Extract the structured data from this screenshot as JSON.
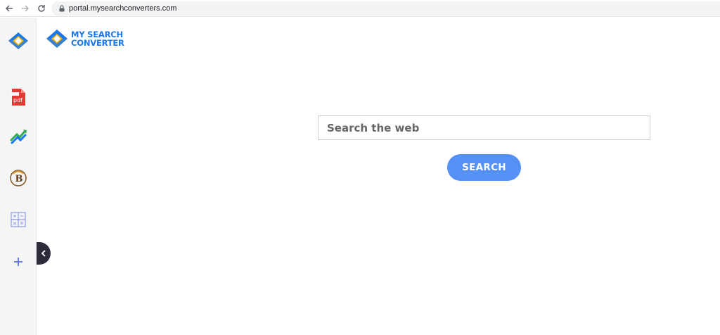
{
  "browser": {
    "url": "portal.mysearchconverters.com"
  },
  "brand": {
    "line1": "MY SEARCH",
    "line2": "CONVERTER"
  },
  "sidebar": {
    "items": [
      {
        "name": "logo",
        "icon": "mysearchconverter-logo-icon"
      },
      {
        "name": "pdf",
        "icon": "pdf-icon",
        "label": "pdf"
      },
      {
        "name": "convert",
        "icon": "convert-arrows-icon"
      },
      {
        "name": "bitcoin",
        "icon": "bitcoin-icon",
        "label": "B"
      },
      {
        "name": "calculator",
        "icon": "calculator-icon"
      },
      {
        "name": "add",
        "icon": "plus-icon"
      }
    ]
  },
  "search": {
    "placeholder": "Search the web",
    "button_label": "SEARCH"
  },
  "colors": {
    "accent": "#5591f5",
    "brand_blue": "#1877f2",
    "brand_yellow": "#f5b400",
    "pdf_red": "#e53935",
    "collapse_tab": "#2b2b3a"
  }
}
